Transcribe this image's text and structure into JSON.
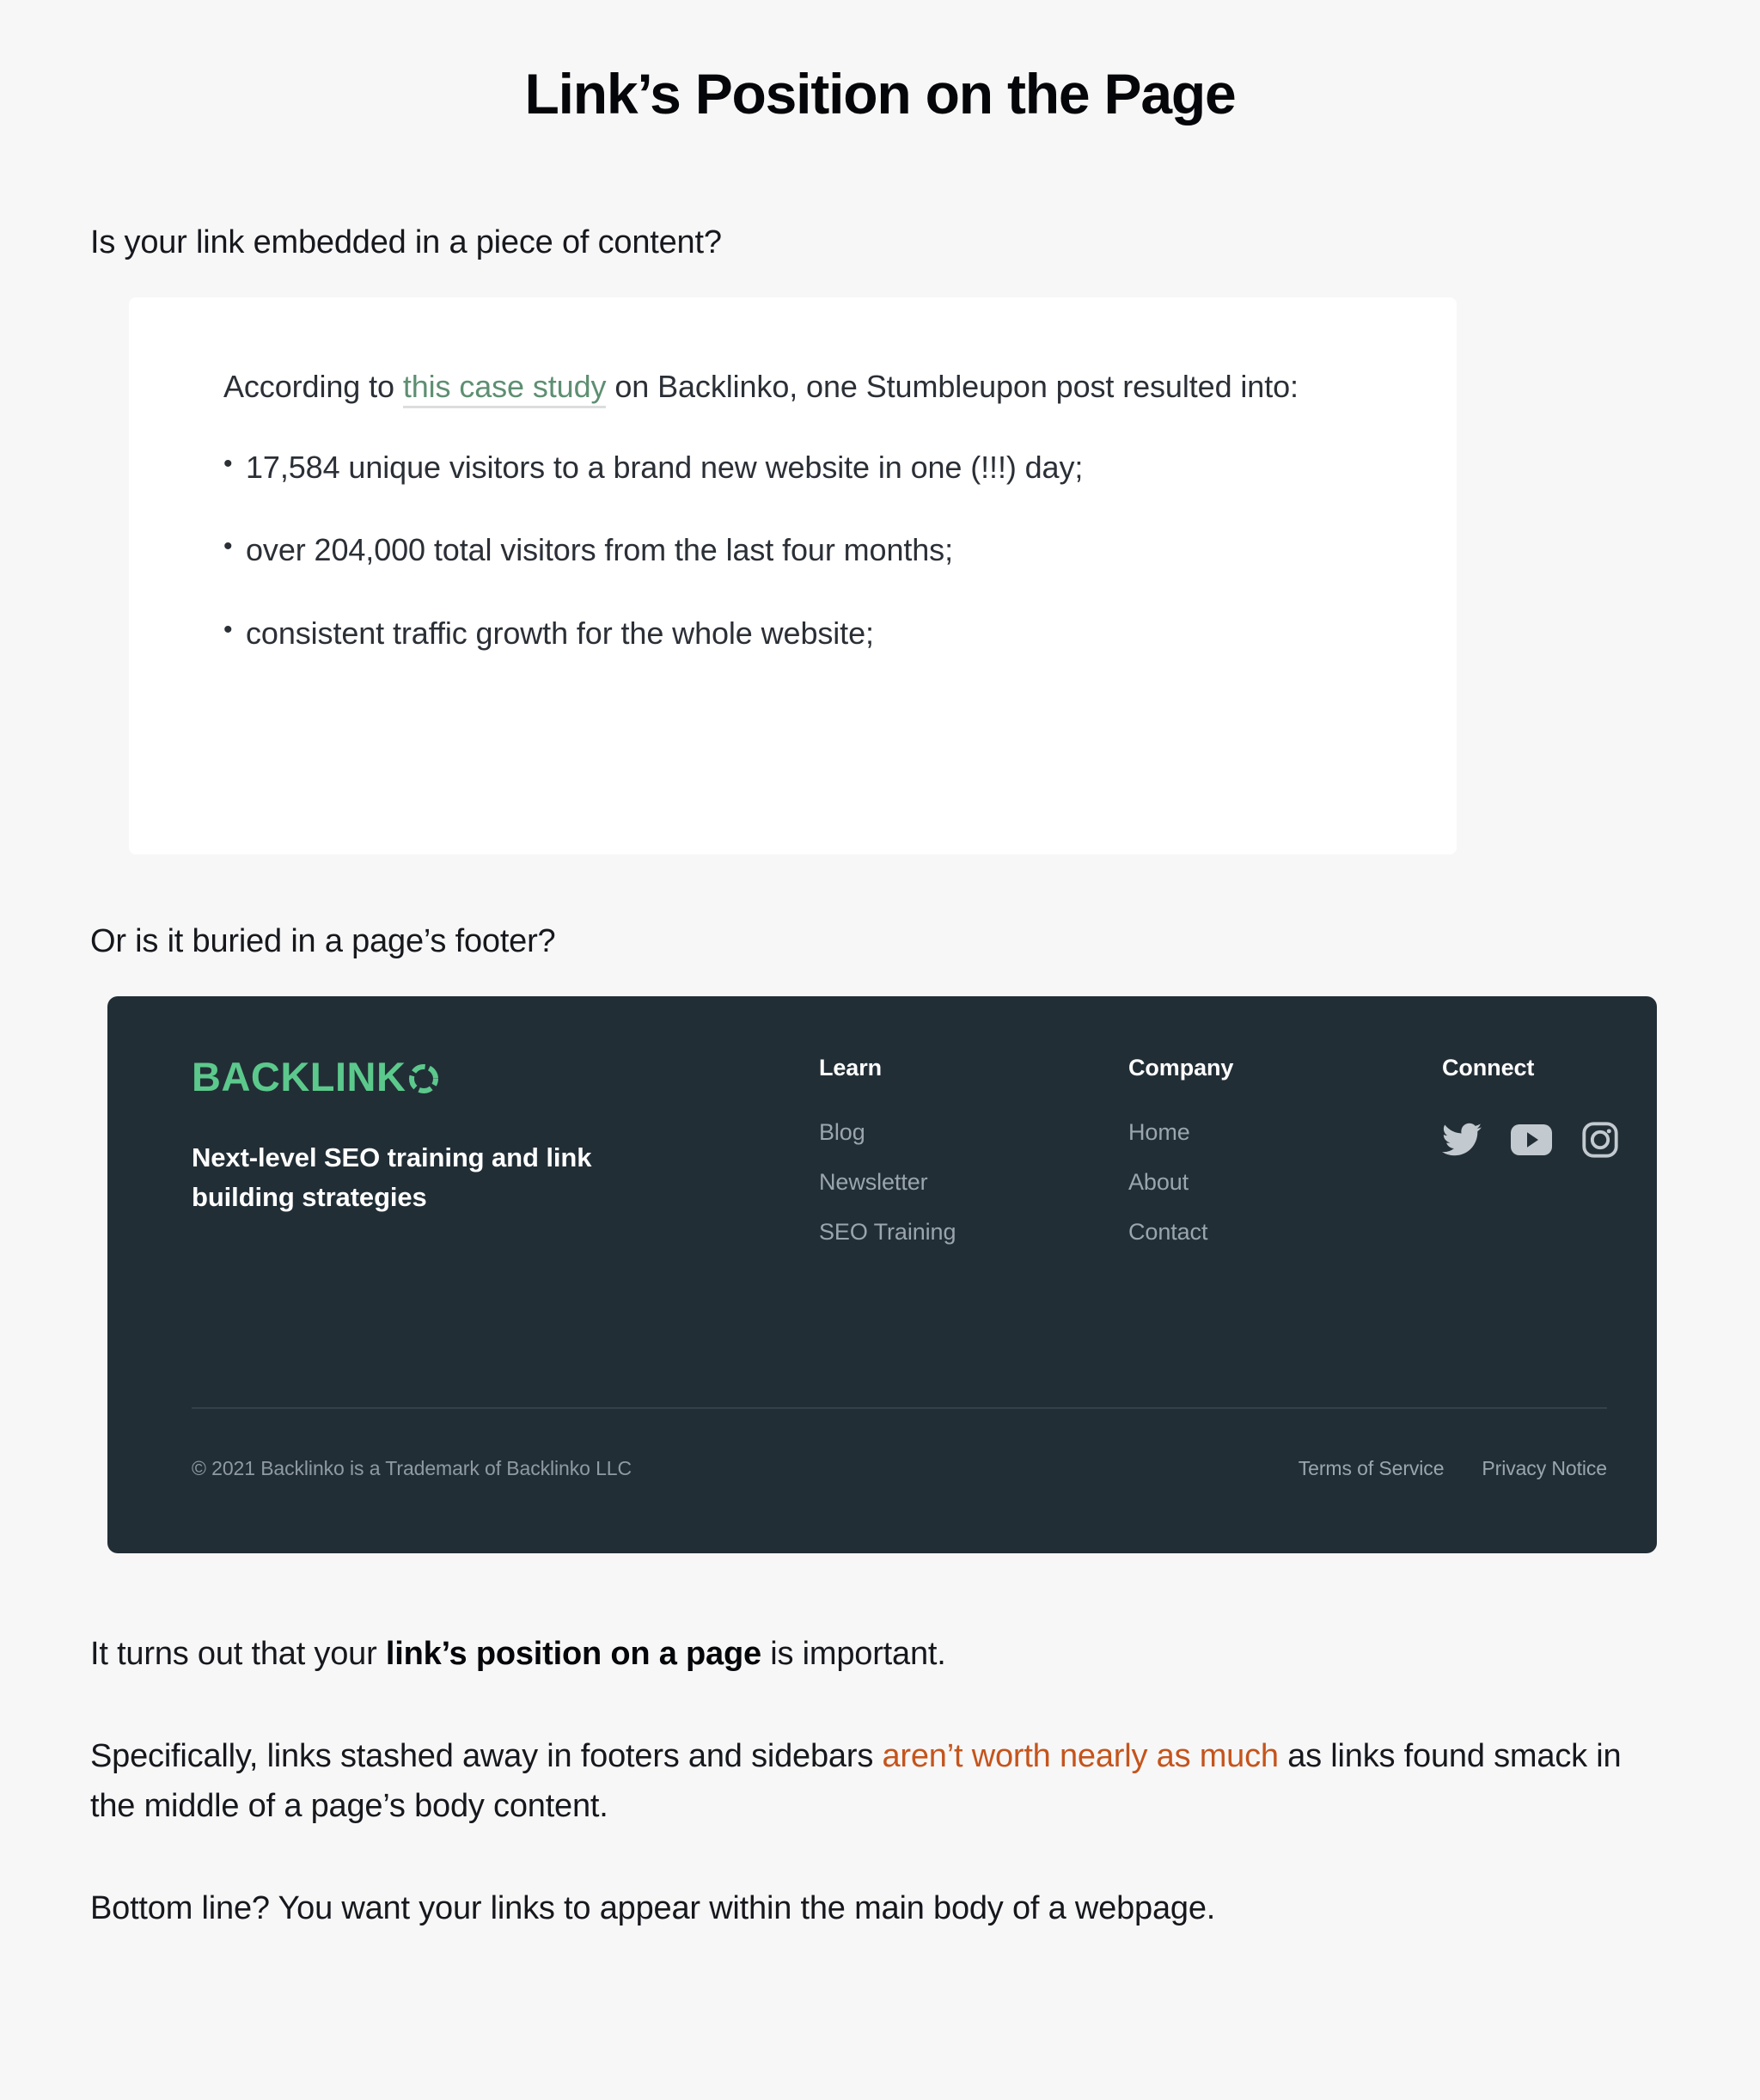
{
  "page": {
    "title": "Link’s Position on the Page",
    "background_color": "#f7f7f7"
  },
  "questions": {
    "q1": "Is your link embedded in a piece of content?",
    "q2": "Or is it buried in a page’s footer?"
  },
  "screenshot_card": {
    "background_color": "#ffffff",
    "lead_part1": "According to ",
    "lead_link": "this case study",
    "lead_link_color": "#5e8f72",
    "lead_part2": " on Backlinko, one Stumbleupon post resulted into:",
    "bullets": [
      "17,584 unique visitors to a brand new website in one (!!!) day;",
      "over 204,000 total visitors from the last four months;",
      "consistent traffic growth for the whole website;"
    ]
  },
  "footer_screenshot": {
    "background_color": "#222e36",
    "brand": {
      "logo_text": "BACKLINK",
      "logo_mark": "ring-o-icon",
      "logo_color": "#5cc98c",
      "tagline": "Next-level SEO training and link building strategies"
    },
    "columns": [
      {
        "title": "Learn",
        "links": [
          "Blog",
          "Newsletter",
          "SEO Training"
        ]
      },
      {
        "title": "Company",
        "links": [
          "Home",
          "About",
          "Contact"
        ]
      }
    ],
    "connect": {
      "title": "Connect",
      "socials": [
        "twitter-icon",
        "youtube-icon",
        "instagram-icon"
      ]
    },
    "bottom": {
      "copyright": "© 2021 Backlinko is a Trademark of Backlinko LLC",
      "legal": [
        "Terms of Service",
        "Privacy Notice"
      ]
    }
  },
  "body_paragraphs": {
    "p1_part1": "It turns out that your ",
    "p1_bold": "link’s position on a page",
    "p1_part2": " is important.",
    "p2_part1": "Specifically, links stashed away in footers and sidebars ",
    "p2_link": "aren’t worth nearly as much",
    "p2_link_color": "#c5541c",
    "p2_part2": " as links found smack in the middle of a page’s body content.",
    "p3": "Bottom line? You want your links to appear within the main body of a webpage."
  }
}
